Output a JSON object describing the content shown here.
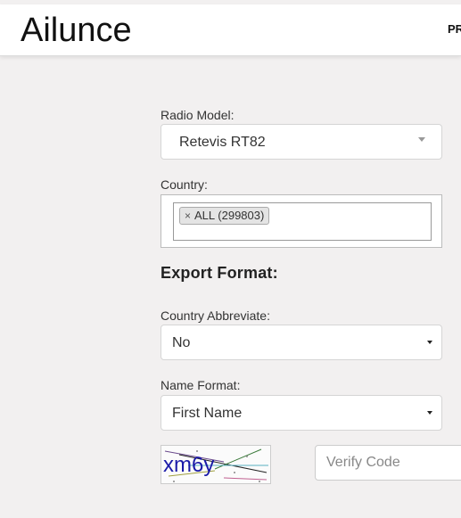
{
  "header": {
    "brand": "Ailunce",
    "nav_partial": "PR"
  },
  "form": {
    "radio_model": {
      "label": "Radio Model:",
      "value": "Retevis RT82"
    },
    "country": {
      "label": "Country:",
      "chip_remove": "×",
      "chip_label": "ALL (299803)"
    },
    "export_format_title": "Export Format:",
    "country_abbreviate": {
      "label": "Country Abbreviate:",
      "value": "No"
    },
    "name_format": {
      "label": "Name Format:",
      "value": "First Name"
    },
    "captcha": {
      "text": "xm6y"
    },
    "verify_code": {
      "placeholder": "Verify Code",
      "value": ""
    }
  },
  "colors": {
    "page_bg": "#f2f0f0",
    "captcha_text": "#1a1aa8"
  }
}
